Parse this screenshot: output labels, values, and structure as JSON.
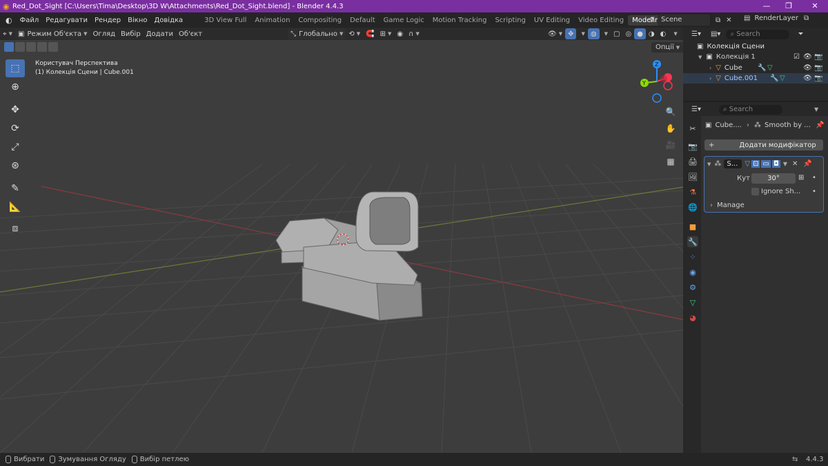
{
  "titlebar": {
    "title": "Red_Dot_Sight [C:\\Users\\Tima\\Desktop\\3D W\\Attachments\\Red_Dot_Sight.blend] - Blender 4.4.3"
  },
  "menu": {
    "file": "Файл",
    "edit": "Редагувати",
    "render": "Рендер",
    "window": "Вікно",
    "help": "Довідка"
  },
  "workspaces": [
    "3D View Full",
    "Animation",
    "Compositing",
    "Default",
    "Game Logic",
    "Motion Tracking",
    "Scripting",
    "UV Editing",
    "Video Editing",
    "Modeling"
  ],
  "active_workspace": "Modeling",
  "scene": {
    "scene_name": "Scene",
    "view_layer": "RenderLayer"
  },
  "viewport_header": {
    "mode": "Режим Об'єкта",
    "view": "Огляд",
    "select": "Вибір",
    "add": "Додати",
    "object": "Об'єкт",
    "orientation": "Глобально",
    "options": "Опції"
  },
  "viewport": {
    "view_name": "Користувач Перспектива",
    "collection_info": "(1) Колекція Сцени | Cube.001"
  },
  "outliner": {
    "search_placeholder": "Search",
    "scene_collection": "Колекція Сцени",
    "collection": "Колекція 1",
    "objects": [
      "Cube",
      "Cube.001"
    ]
  },
  "properties": {
    "search_placeholder": "Search",
    "breadcrumb_object": "Cube....",
    "breadcrumb_modifier": "Smooth by ...",
    "add_modifier": "Додати модифікатор",
    "modifier_name": "S...",
    "angle_label": "Кут",
    "angle_value": "30°",
    "ignore_sharp": "Ignore Sh...",
    "manage": "Manage"
  },
  "statusbar": {
    "select": "Вибрати",
    "zoom": "Зумування Огляду",
    "loop": "Вибір петлею",
    "version": "4.4.3"
  },
  "colors": {
    "titlebar": "#7a2fa0",
    "accent": "#4772b3",
    "x_axis": "#ff3352",
    "y_axis": "#8bdc00",
    "z_axis": "#2890ff"
  },
  "gizmo": {
    "x": "X",
    "y": "Y",
    "z": "Z"
  }
}
